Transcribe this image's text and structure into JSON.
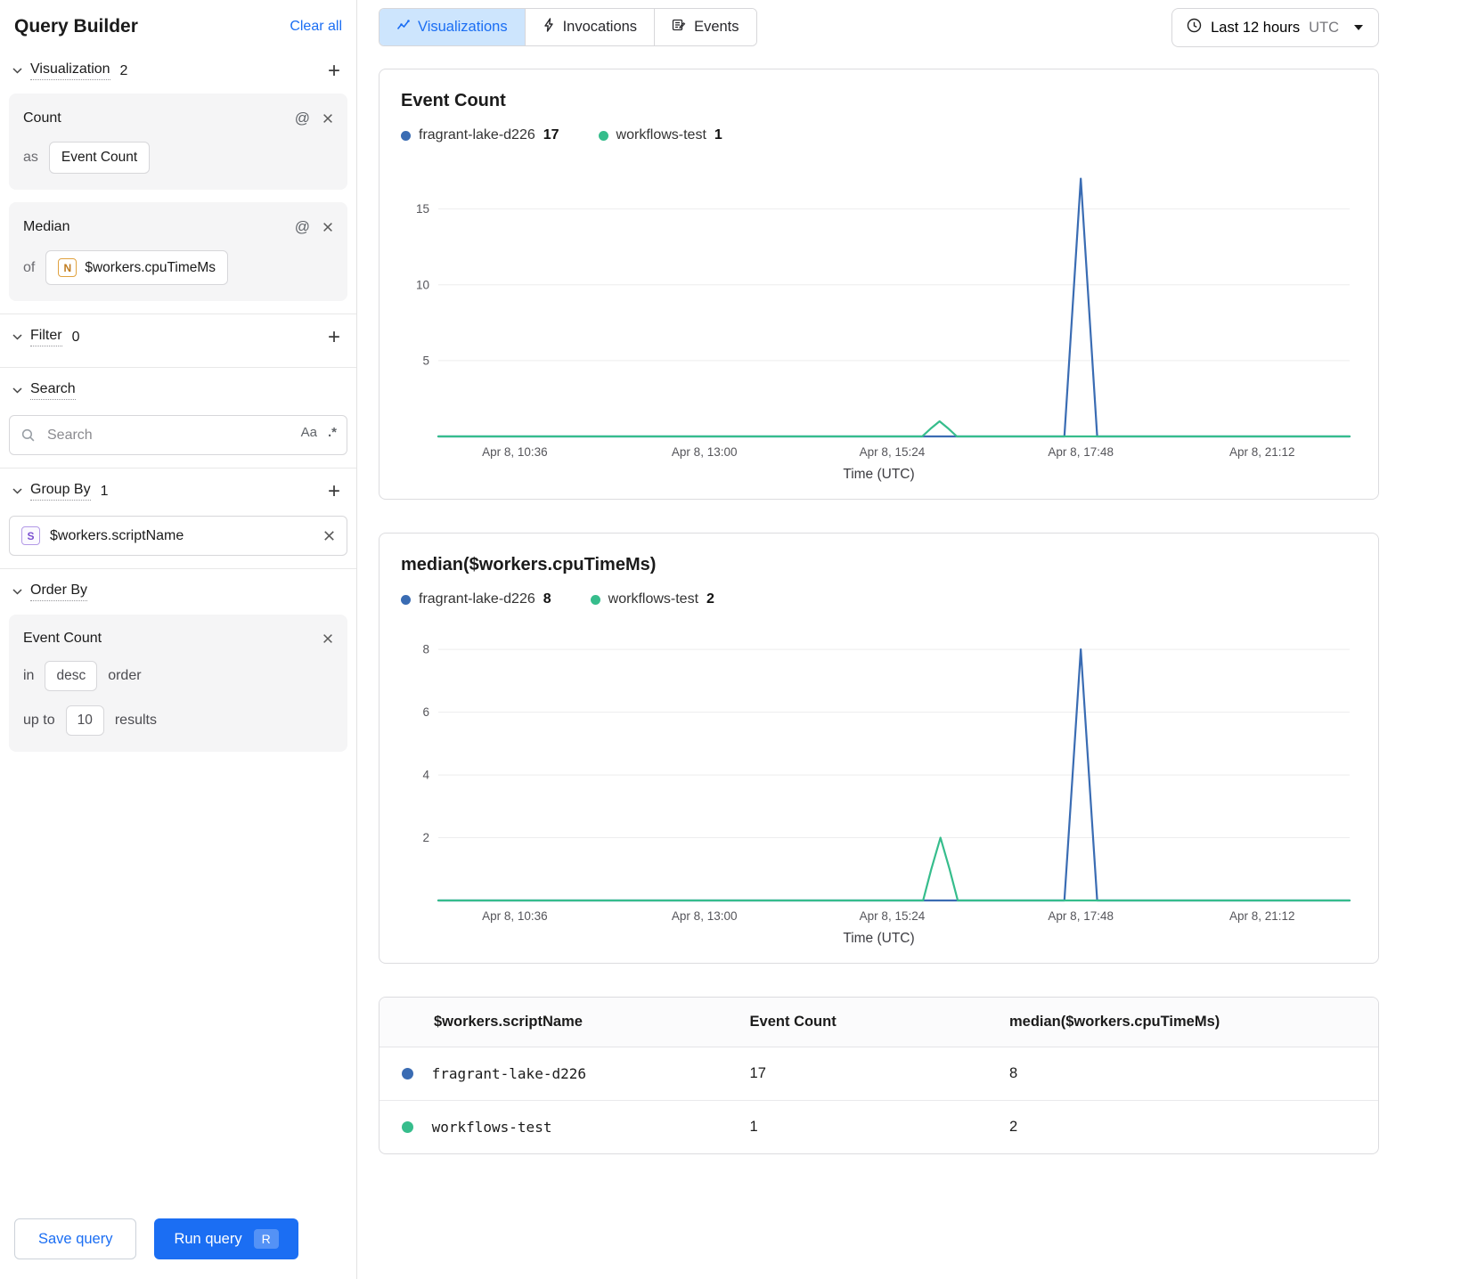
{
  "icons": {
    "plus": "+",
    "at": "@",
    "case_sensitive": "Aa",
    "regex": ".*"
  },
  "accent": {
    "blue": "#1b6ef3",
    "chart_blue": "#3a6cb3",
    "chart_green": "#36bd8c"
  },
  "sidebar": {
    "title": "Query Builder",
    "clear_all": "Clear all",
    "visualization": {
      "label": "Visualization",
      "count": "2"
    },
    "count_card": {
      "title": "Count",
      "as_label": "as",
      "value": "Event Count"
    },
    "median_card": {
      "title": "Median",
      "of_label": "of",
      "badge": "N",
      "value": "$workers.cpuTimeMs"
    },
    "filter": {
      "label": "Filter",
      "count": "0"
    },
    "search": {
      "label": "Search",
      "placeholder": "Search"
    },
    "group_by": {
      "label": "Group By",
      "count": "1",
      "badge": "S",
      "value": "$workers.scriptName"
    },
    "order_by": {
      "label": "Order By",
      "card_title": "Event Count",
      "in_label": "in",
      "direction": "desc",
      "order_label": "order",
      "upto_label": "up to",
      "limit": "10",
      "results_label": "results"
    },
    "save_button": "Save query",
    "run_button": "Run query",
    "run_shortcut": "R"
  },
  "header": {
    "tabs": [
      {
        "label": "Visualizations"
      },
      {
        "label": "Invocations"
      },
      {
        "label": "Events"
      }
    ],
    "time_range": {
      "label": "Last 12 hours",
      "zone": "UTC"
    }
  },
  "chart_data": [
    {
      "type": "line",
      "title": "Event Count",
      "xlabel": "Time (UTC)",
      "ylabel": "",
      "ylim": [
        0,
        17.8
      ],
      "y_ticks": [
        5,
        10,
        15
      ],
      "x_ticks": [
        {
          "label": "Apr 8, 10:36",
          "pos": 0.084
        },
        {
          "label": "Apr 8, 13:00",
          "pos": 0.292
        },
        {
          "label": "Apr 8, 15:24",
          "pos": 0.498
        },
        {
          "label": "Apr 8, 17:48",
          "pos": 0.705
        },
        {
          "label": "Apr 8, 21:12",
          "pos": 0.904
        }
      ],
      "grid": true,
      "legend_position": "top",
      "series": [
        {
          "name": "fragrant-lake-d226",
          "legend_value": "17",
          "color": "#3a6cb3",
          "points": [
            [
              0,
              0
            ],
            [
              0.687,
              0
            ],
            [
              0.696,
              8.5
            ],
            [
              0.705,
              17
            ],
            [
              0.714,
              8.5
            ],
            [
              0.723,
              0
            ],
            [
              1,
              0
            ]
          ]
        },
        {
          "name": "workflows-test",
          "legend_value": "1",
          "color": "#36bd8c",
          "points": [
            [
              0,
              0
            ],
            [
              0.531,
              0
            ],
            [
              0.541,
              0.55
            ],
            [
              0.55,
              1
            ],
            [
              0.559,
              0.55
            ],
            [
              0.569,
              0
            ],
            [
              1,
              0
            ]
          ]
        }
      ]
    },
    {
      "type": "line",
      "title": "median($workers.cpuTimeMs)",
      "xlabel": "Time (UTC)",
      "ylabel": "",
      "ylim": [
        0,
        8.6
      ],
      "y_ticks": [
        2,
        4,
        6,
        8
      ],
      "x_ticks": [
        {
          "label": "Apr 8, 10:36",
          "pos": 0.084
        },
        {
          "label": "Apr 8, 13:00",
          "pos": 0.292
        },
        {
          "label": "Apr 8, 15:24",
          "pos": 0.498
        },
        {
          "label": "Apr 8, 17:48",
          "pos": 0.705
        },
        {
          "label": "Apr 8, 21:12",
          "pos": 0.904
        }
      ],
      "grid": true,
      "legend_position": "top",
      "series": [
        {
          "name": "fragrant-lake-d226",
          "legend_value": "8",
          "color": "#3a6cb3",
          "points": [
            [
              0,
              0
            ],
            [
              0.687,
              0
            ],
            [
              0.696,
              4
            ],
            [
              0.705,
              8
            ],
            [
              0.714,
              4
            ],
            [
              0.723,
              0
            ],
            [
              1,
              0
            ]
          ]
        },
        {
          "name": "workflows-test",
          "legend_value": "2",
          "color": "#36bd8c",
          "points": [
            [
              0,
              0
            ],
            [
              0.532,
              0
            ],
            [
              0.541,
              1
            ],
            [
              0.551,
              2
            ],
            [
              0.561,
              1
            ],
            [
              0.57,
              0
            ],
            [
              1,
              0
            ]
          ]
        }
      ]
    }
  ],
  "table": {
    "columns": [
      "$workers.scriptName",
      "Event Count",
      "median($workers.cpuTimeMs)"
    ],
    "rows": [
      {
        "color": "#3a6cb3",
        "name": "fragrant-lake-d226",
        "event_count": "17",
        "median": "8"
      },
      {
        "color": "#36bd8c",
        "name": "workflows-test",
        "event_count": "1",
        "median": "2"
      }
    ]
  }
}
